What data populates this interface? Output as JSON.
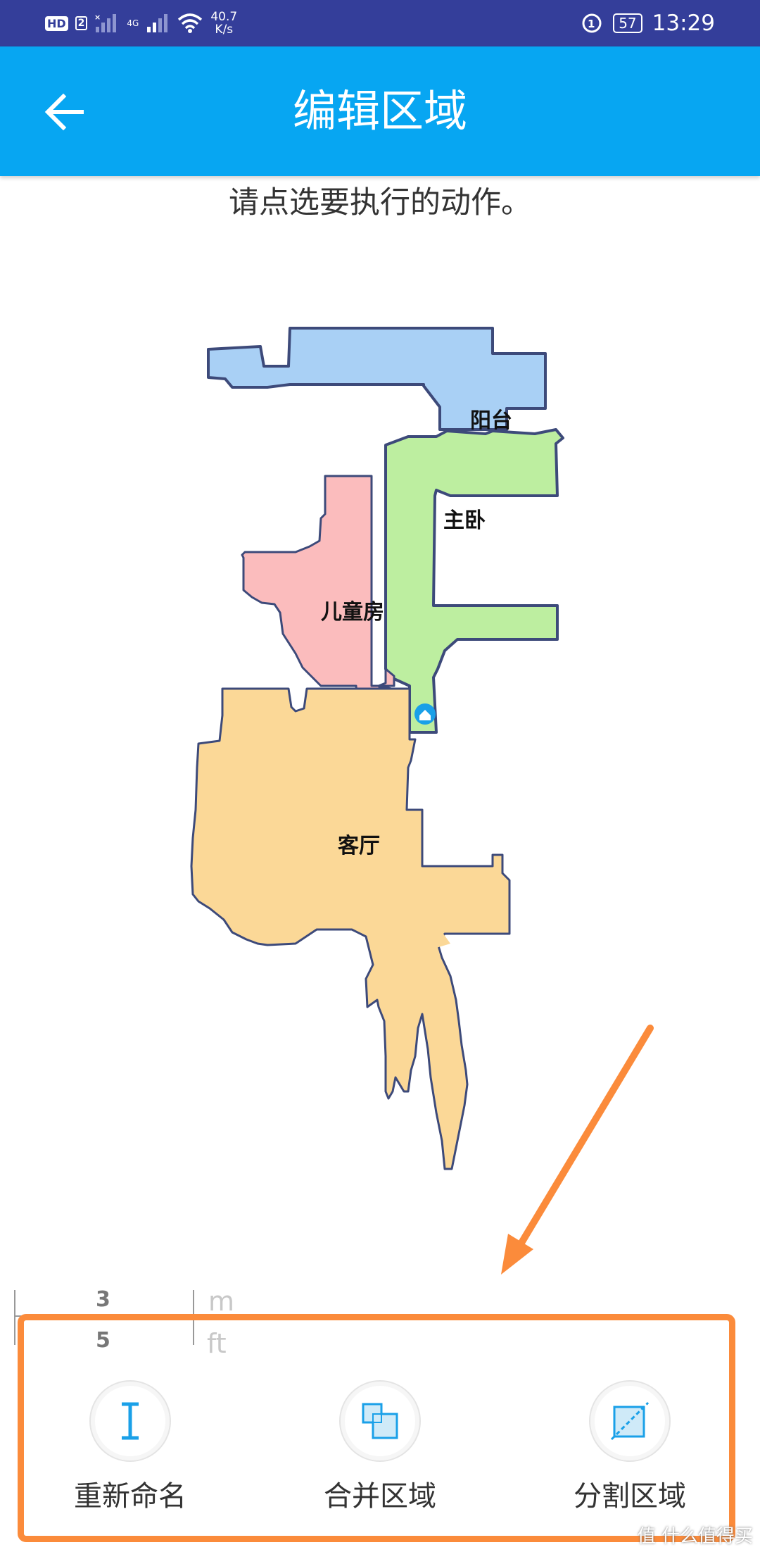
{
  "status_bar": {
    "hd_label": "HD",
    "sim_label": "2",
    "network_label": "4G",
    "speed_value": "40.7",
    "speed_unit": "K/s",
    "battery": "57",
    "time": "13:29"
  },
  "app_bar": {
    "title": "编辑区域"
  },
  "instruction": "请点选要执行的动作。",
  "map": {
    "rooms": [
      {
        "name": "阳台",
        "color": "#a9d0f5"
      },
      {
        "name": "主卧",
        "color": "#bdeea0"
      },
      {
        "name": "儿童房",
        "color": "#fbbcbd"
      },
      {
        "name": "客厅",
        "color": "#fbd897"
      }
    ],
    "outline_color": "#3d4a7a"
  },
  "scale": {
    "top_value": "3",
    "bottom_value": "5",
    "top_unit": "m",
    "bottom_unit": "ft"
  },
  "actions": [
    {
      "label": "重新命名",
      "icon": "text-cursor-icon"
    },
    {
      "label": "合并区域",
      "icon": "merge-squares-icon"
    },
    {
      "label": "分割区域",
      "icon": "split-square-icon"
    }
  ],
  "colors": {
    "status_bar": "#343e9a",
    "app_bar": "#07a6f2",
    "accent": "#1aa0e8",
    "highlight": "#fb8b3b"
  },
  "watermark": "值 什么值得买"
}
